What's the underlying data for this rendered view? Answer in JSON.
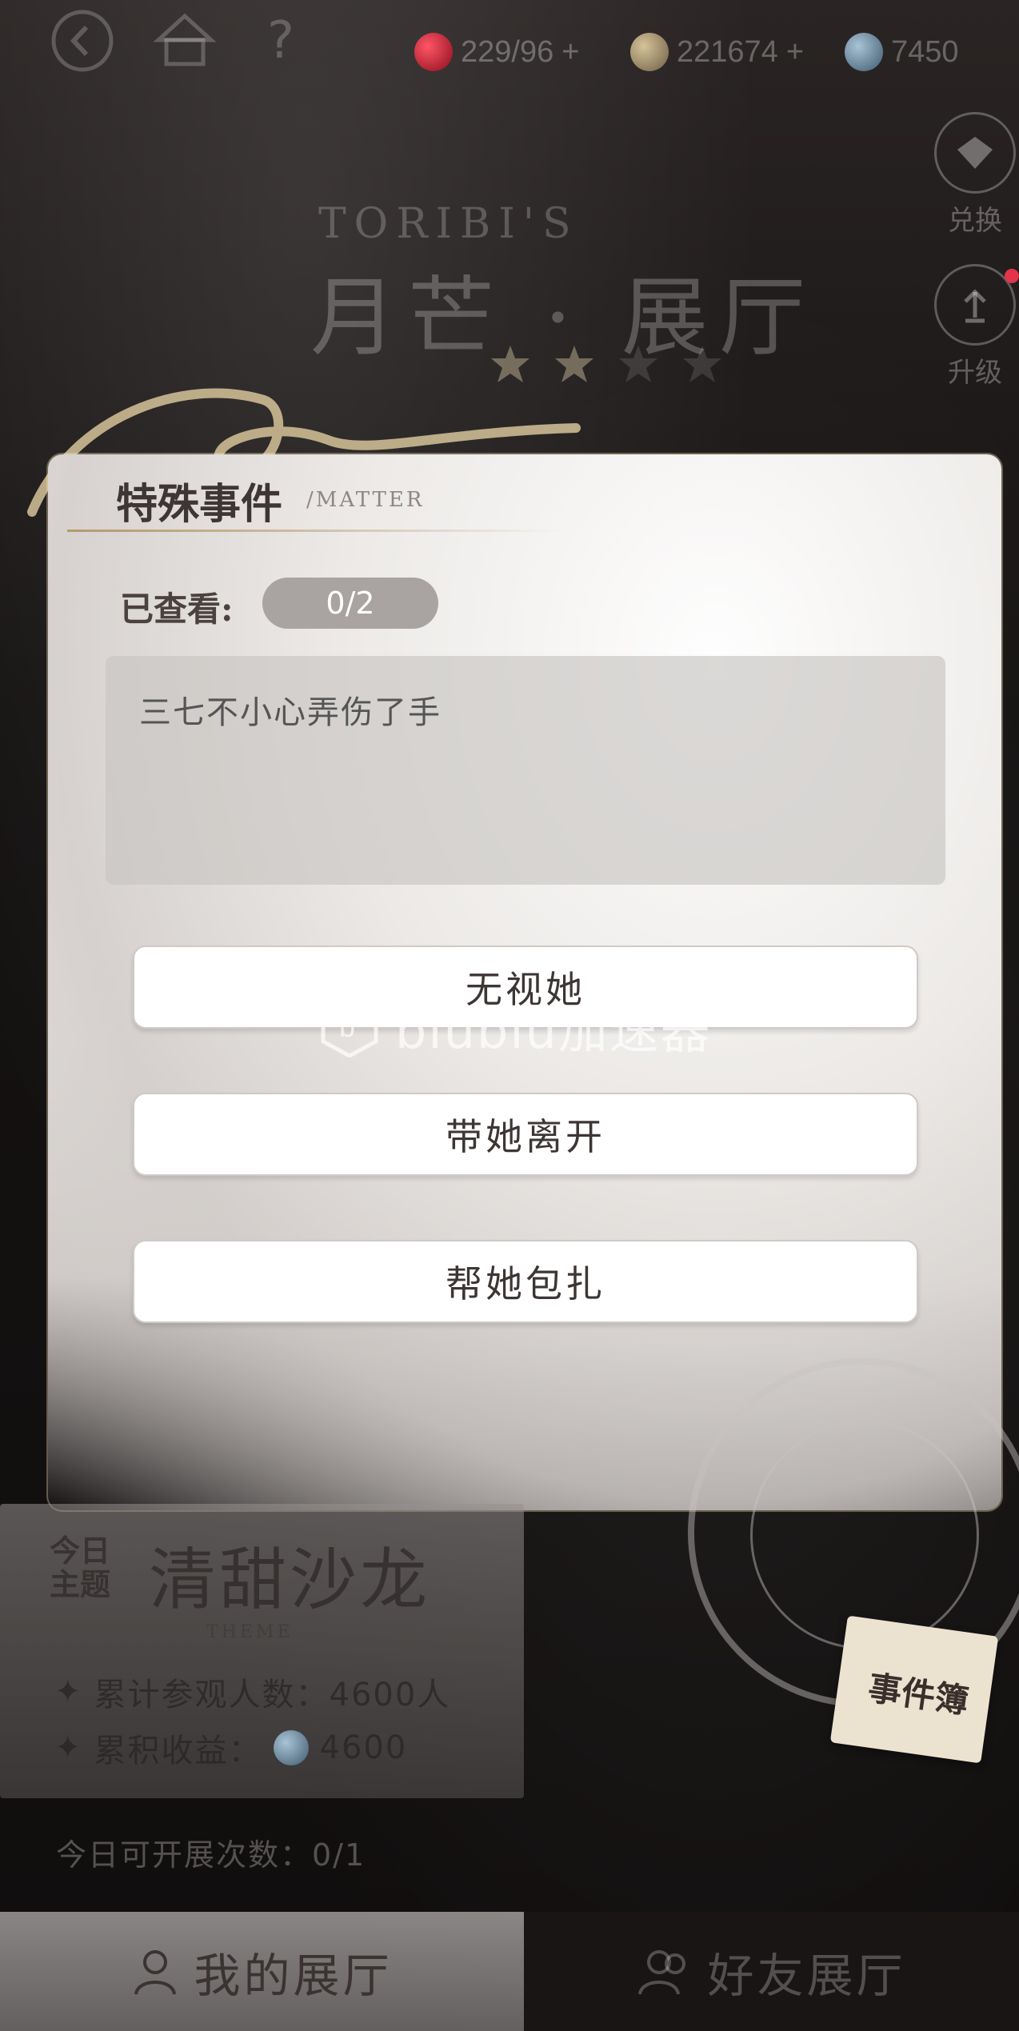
{
  "header": {
    "icons": [
      "back-icon",
      "home-icon",
      "help-icon"
    ],
    "help_glyph": "?",
    "resources": [
      {
        "icon": "ruby-icon",
        "value": "229/96",
        "plus": "+",
        "color": "#c0182a"
      },
      {
        "icon": "gold-coin-icon",
        "value": "221674",
        "plus": "+",
        "color": "#9a8a6c"
      },
      {
        "icon": "blue-gem-icon",
        "value": "7450",
        "plus": "",
        "color": "#6d8aa0"
      }
    ]
  },
  "side_buttons": [
    {
      "icon": "exchange-icon",
      "label": "兑换"
    },
    {
      "icon": "upgrade-icon",
      "label": "升级"
    }
  ],
  "brand": {
    "en": "TORIBI'S",
    "zh": "月芒 · 展厅",
    "stars_filled": 2,
    "stars_total": 4
  },
  "panel": {
    "title": "特殊事件",
    "title_en": "/MATTER",
    "viewed_label": "已查看:",
    "viewed_value": "0/2",
    "event_text": "三七不小心弄伤了手",
    "choices": [
      "无视她",
      "带她离开",
      "帮她包扎"
    ]
  },
  "theme": {
    "tag": "今日主题",
    "name": "清甜沙龙",
    "en": "THEME",
    "visitors_label": "累计参观人数：4600人",
    "income_label": "累积收益：",
    "income_value": "4600"
  },
  "open_count": "今日可开展次数：0/1",
  "notebook_label": "事件簿",
  "watermark": "biubiu加速器",
  "tabs": {
    "mine": "我的展厅",
    "friend": "好友展厅"
  }
}
